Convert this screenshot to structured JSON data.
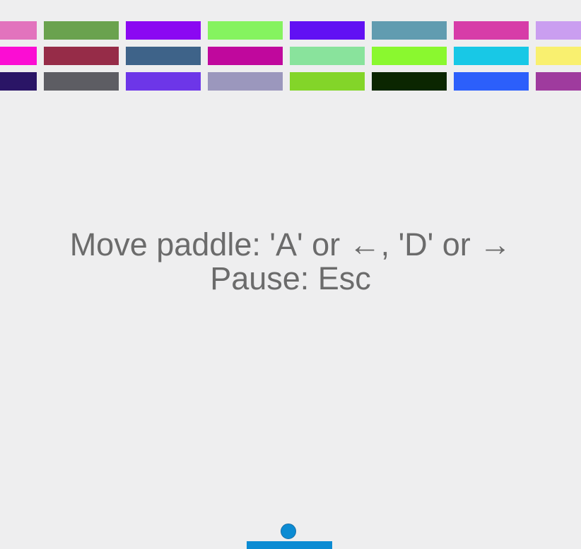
{
  "instructions": {
    "move": "Move paddle: 'A' or ←, 'D' or →",
    "pause": "Pause: Esc"
  },
  "bricks": {
    "rows": [
      [
        "#e273bd",
        "#6aa24e",
        "#8b08f2",
        "#85f35f",
        "#6110f3",
        "#619cb0",
        "#d73ca8",
        "#ca9ef0"
      ],
      [
        "#fb0dd3",
        "#962c48",
        "#3e6389",
        "#c0089d",
        "#89e39c",
        "#8af82f",
        "#18c8e6",
        "#f9f06f"
      ],
      [
        "#2a1566",
        "#5d5d63",
        "#6d36e8",
        "#9b97bd",
        "#83d529",
        "#0b2601",
        "#2c5ffb",
        "#9f3b9e"
      ]
    ]
  },
  "paddle": {
    "color": "#0b8bd3"
  },
  "ball": {
    "color": "#0b8bd3"
  }
}
